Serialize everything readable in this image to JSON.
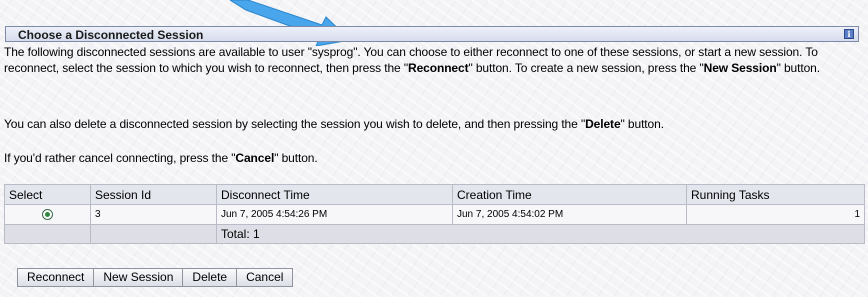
{
  "panel": {
    "title": "Choose a Disconnected Session",
    "info_icon": "info-icon"
  },
  "description": {
    "part1": "The following disconnected sessions are available to user \"sysprog\".  You can choose to either reconnect to one of these sessions, or start a new session.  To reconnect, select the session to which you wish to reconnect, then press the \"",
    "reconnect": "Reconnect",
    "part2": "\" button.  To create a new session, press the \"",
    "new_session": "New Session",
    "part3": "\" button."
  },
  "delete_line": {
    "part1": "You can also delete a disconnected session by selecting the session you wish to delete, and then pressing the \"",
    "word": "Delete",
    "part2": "\" button."
  },
  "cancel_line": {
    "part1": "If you'd rather cancel connecting, press the \"",
    "word": "Cancel",
    "part2": "\" button."
  },
  "table": {
    "headers": [
      "Select",
      "Session Id",
      "Disconnect Time",
      "Creation Time",
      "Running Tasks"
    ],
    "rows": [
      {
        "selected": true,
        "session_id": "3",
        "disconnect_time": "Jun 7, 2005 4:54:26 PM",
        "creation_time": "Jun 7, 2005 4:54:02 PM",
        "running_tasks": "1"
      }
    ],
    "total": "Total: 1"
  },
  "buttons": {
    "reconnect": "Reconnect",
    "new_session": "New Session",
    "delete": "Delete",
    "cancel": "Cancel"
  },
  "colors": {
    "arrow": "#4aa6ec",
    "header_border": "#7e8ba6",
    "radio_selected": "#2f8a3e"
  }
}
